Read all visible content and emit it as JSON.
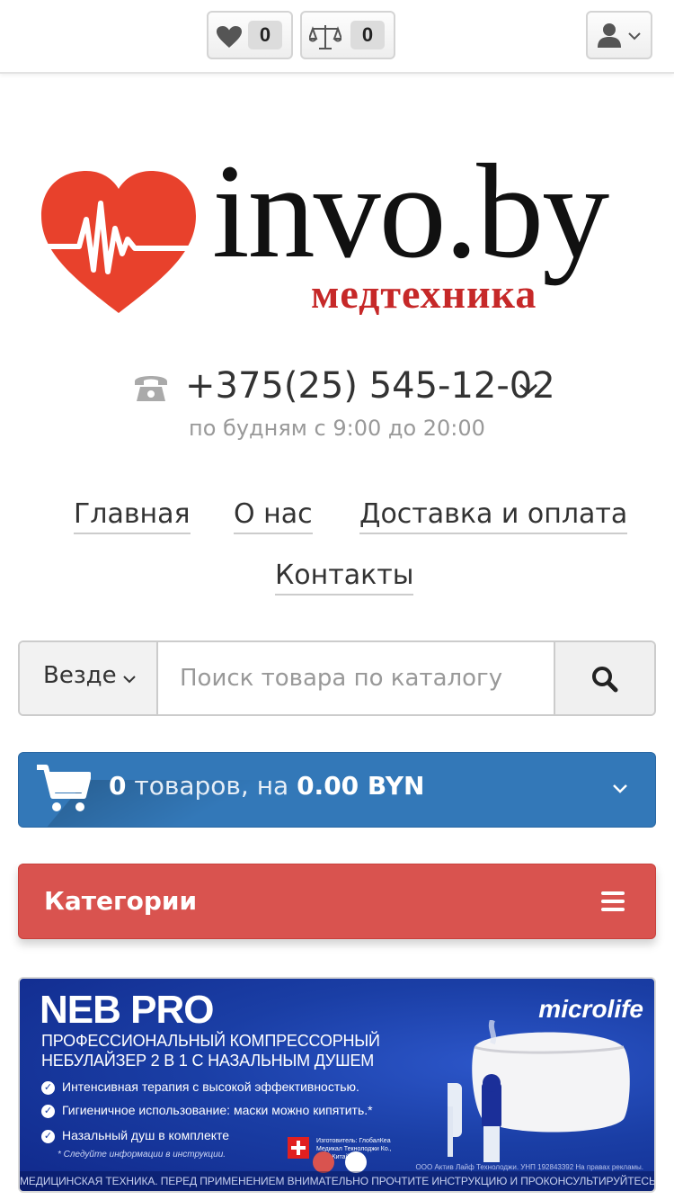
{
  "topbar": {
    "wishlist_count": "0",
    "compare_count": "0"
  },
  "logo": {
    "text": "invo.by",
    "subtitle": "медтехника"
  },
  "contact": {
    "phone": "+375(25) 545-12-02",
    "hours": "по будням с 9:00 до 20:00"
  },
  "nav": {
    "home": "Главная",
    "about": "О нас",
    "delivery": "Доставка и оплата",
    "contacts": "Контакты"
  },
  "search": {
    "scope": "Везде",
    "placeholder": "Поиск товара по каталогу"
  },
  "cart": {
    "count": "0",
    "items_word": "товаров, на",
    "total": "0.00 BYN"
  },
  "categories": {
    "label": "Категории"
  },
  "banner": {
    "title": "NEB PRO",
    "brand": "microlife",
    "subtitle_line1": "ПРОФЕССИОНАЛЬНЫЙ КОМПРЕССОРНЫЙ",
    "subtitle_line2": "НЕБУЛАЙЗЕР 2 В 1 С НАЗАЛЬНЫМ ДУШЕМ",
    "bullets": [
      "Интенсивная терапия с высокой эффективностью.",
      "Гигиеничное использование: маски можно кипятить.*",
      "Назальный душ в комплекте"
    ],
    "note": "* Следуйте информации в инструкции.",
    "maker": "Изготовитель: ГлобалКеа Медикал Текнолоджи Ко., Лтд., Китай.",
    "legal": "ООО Актив Лайф Технолоджи. УНП 192843392 На правах рекламы.",
    "footer": "МЕДИЦИНСКАЯ ТЕХНИКА. ПЕРЕД ПРИМЕНЕНИЕМ ВНИМАТЕЛЬНО ПРОЧТИТЕ ИНСТРУКЦИЮ И ПРОКОНСУЛЬТИРУЙТЕСЬ С ВРАЧОМ"
  },
  "colors": {
    "cart_bg": "#3378b8",
    "categories_bg": "#d9534f",
    "logo_heart": "#e8412c",
    "logo_subtitle": "#c62828"
  }
}
